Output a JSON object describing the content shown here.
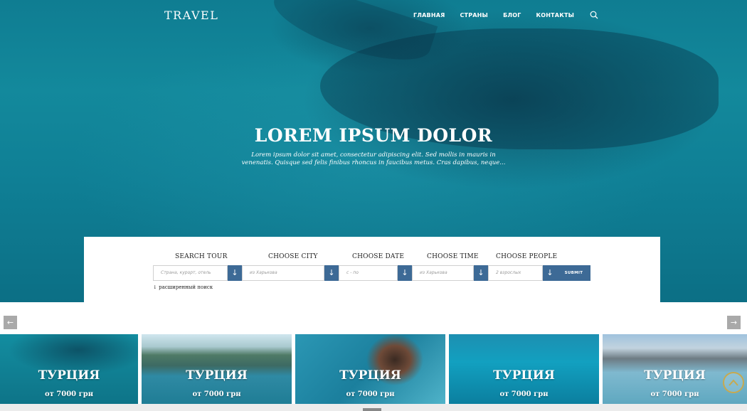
{
  "header": {
    "logo": "TRAVEL",
    "nav": [
      "ГЛАВНАЯ",
      "СТРАНЫ",
      "БЛОГ",
      "КОНТАКТЫ"
    ],
    "search_icon": "search-icon"
  },
  "hero": {
    "title": "LOREM IPSUM DOLOR",
    "subtitle": "Lorem ipsum dolor sit amet, consectetur adipiscing elit. Sed mollis in mauris in venenatis. Quisque sed felis finibus rhoncus in faucibus metus. Cras dapibus, neque..."
  },
  "search": {
    "fields": [
      {
        "label": "SEARCH TOUR",
        "placeholder": "Страна, курорт, отель"
      },
      {
        "label": "CHOOSE CITY",
        "placeholder": "из Харькова"
      },
      {
        "label": "CHOOSE DATE",
        "placeholder": "с - по"
      },
      {
        "label": "CHOOSE TIME",
        "placeholder": "из Харькова"
      },
      {
        "label": "CHOOSE PEOPLE",
        "placeholder": "2 взрослых"
      }
    ],
    "dropdown_glyph": "↓",
    "submit_label": "SUBMIT",
    "advanced_label": "↓ расширенный поиск"
  },
  "carousel": {
    "prev": "←",
    "next": "→",
    "cards": [
      {
        "title": "ТУРЦИЯ",
        "price": "от 7000 грн"
      },
      {
        "title": "ТУРЦИЯ",
        "price": "от 7000 грн"
      },
      {
        "title": "ТУРЦИЯ",
        "price": "от 7000 грн"
      },
      {
        "title": "ТУРЦИЯ",
        "price": "от 7000 грн"
      },
      {
        "title": "ТУРЦИЯ",
        "price": "от 7000 грн"
      }
    ]
  },
  "colors": {
    "accent": "#3d6a96",
    "hero_sea": "#12879b"
  }
}
